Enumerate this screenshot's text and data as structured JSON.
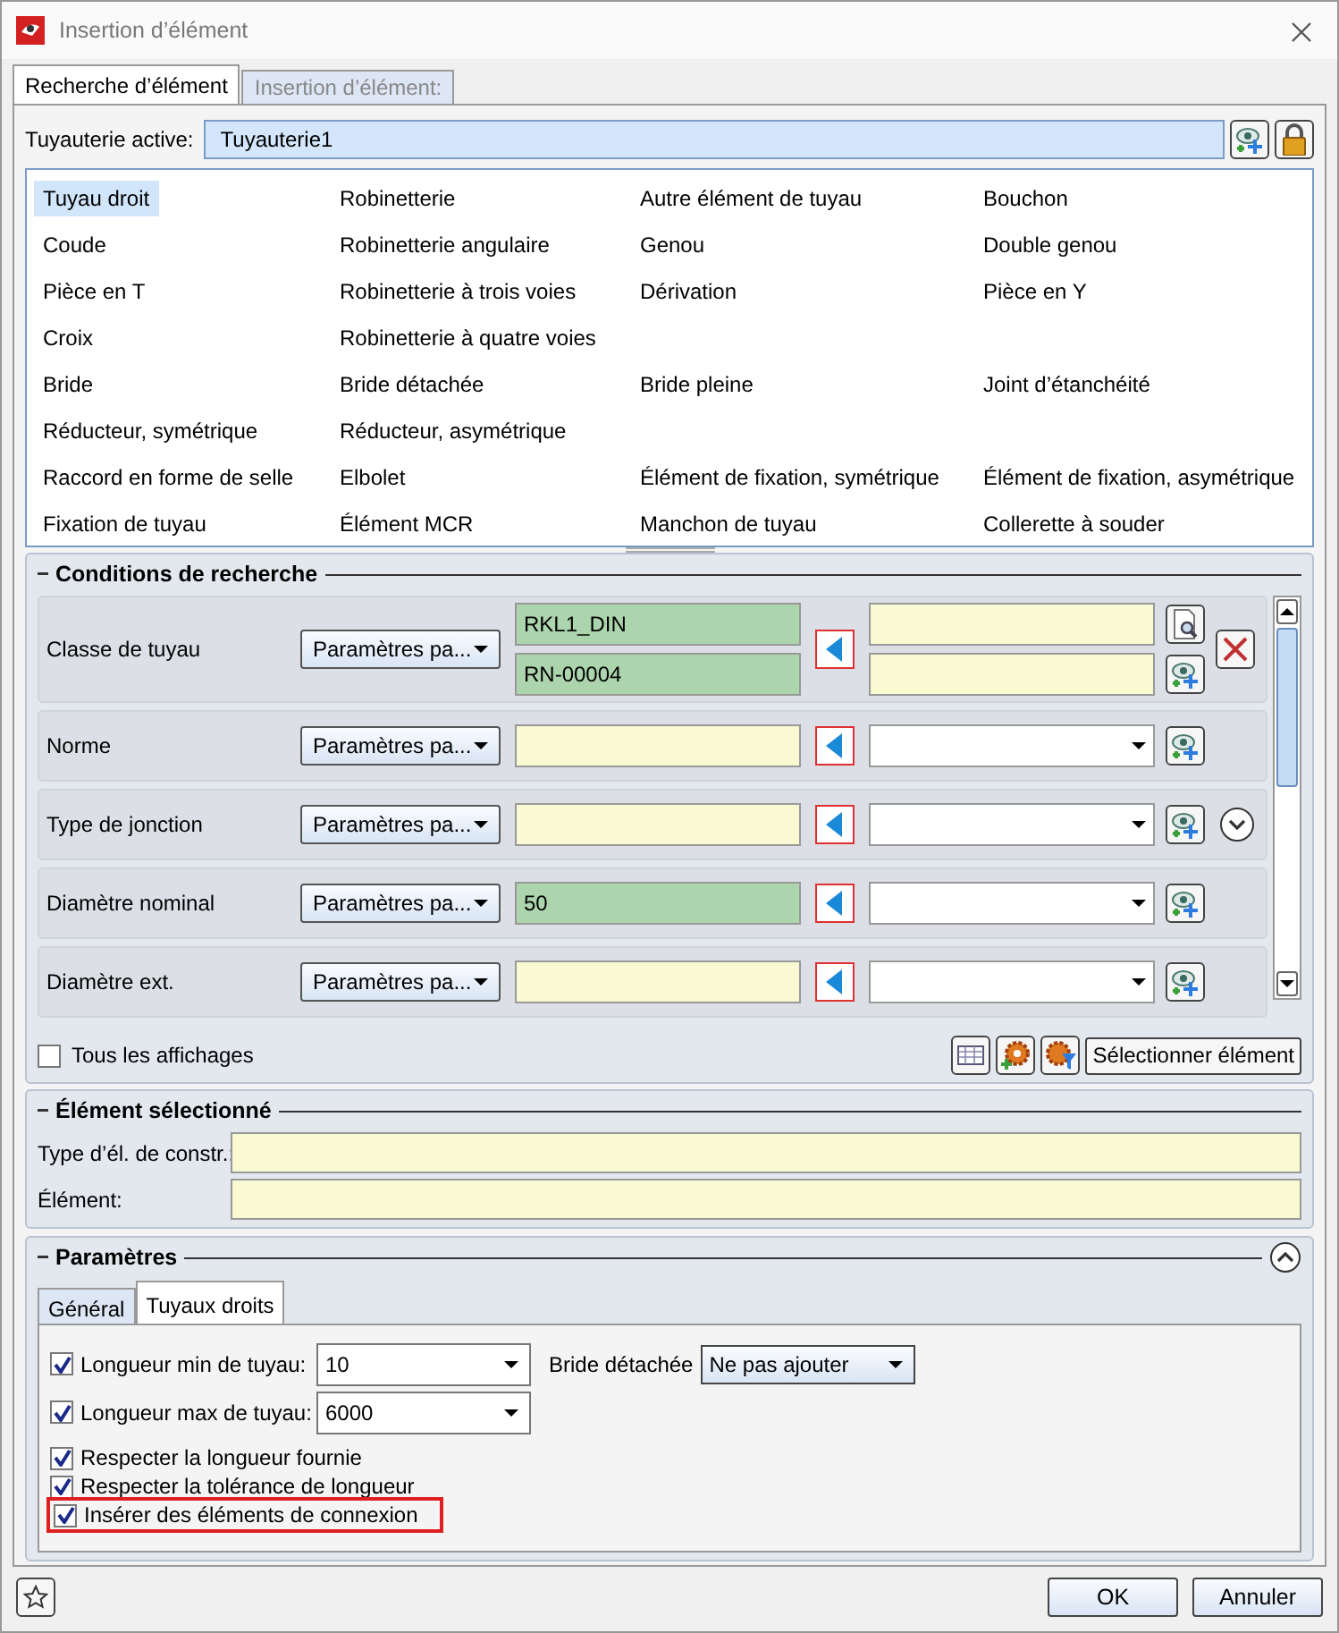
{
  "window": {
    "title": "Insertion d’élément"
  },
  "tabs": [
    {
      "label": "Recherche d’élément",
      "selected": true
    },
    {
      "label": "Insertion d’élément:",
      "selected": false
    }
  ],
  "active_piping": {
    "label": "Tuyauterie active:",
    "value": "Tuyauterie1"
  },
  "element_rows": [
    [
      {
        "label": "Tuyau droit",
        "selected": true
      },
      {
        "label": "Robinetterie",
        "selected": false
      },
      {
        "label": "Autre élément de tuyau",
        "selected": false
      },
      {
        "label": "Bouchon",
        "selected": false
      }
    ],
    [
      {
        "label": "Coude",
        "selected": false
      },
      {
        "label": "Robinetterie angulaire",
        "selected": false
      },
      {
        "label": "Genou",
        "selected": false
      },
      {
        "label": "Double genou",
        "selected": false
      }
    ],
    [
      {
        "label": "Pièce en T",
        "selected": false
      },
      {
        "label": "Robinetterie à trois voies",
        "selected": false
      },
      {
        "label": "Dérivation",
        "selected": false
      },
      {
        "label": "Pièce en Y",
        "selected": false
      }
    ],
    [
      {
        "label": "Croix",
        "selected": false
      },
      {
        "label": "Robinetterie à quatre voies",
        "selected": false
      }
    ],
    [
      {
        "label": "Bride",
        "selected": false
      },
      {
        "label": "Bride détachée",
        "selected": false
      },
      {
        "label": "Bride pleine",
        "selected": false
      },
      {
        "label": "Joint d’étanchéité",
        "selected": false
      }
    ],
    [
      {
        "label": "Réducteur, symétrique",
        "selected": false
      },
      {
        "label": "Réducteur, asymétrique",
        "selected": false
      }
    ],
    [
      {
        "label": "Raccord en forme de selle",
        "selected": false
      },
      {
        "label": "Elbolet",
        "selected": false
      },
      {
        "label": "Élément de fixation, symétrique",
        "selected": false
      },
      {
        "label": "Élément de fixation, asymétrique",
        "selected": false
      }
    ],
    [
      {
        "label": "Fixation de tuyau",
        "selected": false
      },
      {
        "label": "Élément MCR",
        "selected": false
      },
      {
        "label": "Manchon de tuyau",
        "selected": false
      },
      {
        "label": "Collerette à souder",
        "selected": false
      }
    ]
  ],
  "search_conditions": {
    "title": "Conditions de recherche",
    "rows": [
      {
        "kind": "pair",
        "label": "Classe de tuyau",
        "mode": "Paramètres pa...",
        "values": [
          {
            "kind": "set",
            "value": "RKL1_DIN"
          },
          {
            "kind": "set",
            "value": "RN-00004"
          }
        ],
        "targets": [
          {
            "kind": "text"
          },
          {
            "kind": "text"
          }
        ]
      },
      {
        "kind": "single",
        "label": "Norme",
        "mode": "Paramètres pa...",
        "values": [
          {
            "kind": "empty"
          }
        ],
        "targets": [
          {
            "kind": "combo"
          }
        ]
      },
      {
        "kind": "expandable",
        "label": "Type de jonction",
        "mode": "Paramètres pa...",
        "values": [
          {
            "kind": "empty"
          }
        ],
        "targets": [
          {
            "kind": "combo"
          }
        ]
      },
      {
        "kind": "single",
        "label": "Diamètre nominal",
        "mode": "Paramètres pa...",
        "values": [
          {
            "kind": "set",
            "value": "50"
          }
        ],
        "targets": [
          {
            "kind": "combo"
          }
        ]
      },
      {
        "kind": "single",
        "label": "Diamètre ext.",
        "mode": "Paramètres pa...",
        "values": [
          {
            "kind": "empty"
          }
        ],
        "targets": [
          {
            "kind": "combo"
          }
        ]
      }
    ],
    "show_all": {
      "label": "Tous les affichages",
      "checked": false
    },
    "select_button": "Sélectionner élément"
  },
  "selected_element": {
    "title": "Élément sélectionné",
    "fields": [
      {
        "label": "Type d’él. de constr.:"
      },
      {
        "label": "Élément:"
      }
    ]
  },
  "parameters": {
    "title": "Paramètres",
    "tabs": [
      {
        "label": "Général",
        "selected": false
      },
      {
        "label": "Tuyaux droits",
        "selected": true
      }
    ],
    "options": [
      {
        "kind": "combo",
        "checked": true,
        "label": "Longueur min de tuyau:",
        "value": "10",
        "side_label": "Bride détachée",
        "side_value": "Ne pas ajouter"
      },
      {
        "kind": "combo",
        "checked": true,
        "label": "Longueur max de tuyau:",
        "value": "6000"
      },
      {
        "kind": "check",
        "checked": true,
        "label": "Respecter la longueur fournie"
      },
      {
        "kind": "check",
        "checked": true,
        "label": "Respecter la tolérance de longueur"
      },
      {
        "kind": "check",
        "checked": true,
        "label": "Insérer des éléments de connexion",
        "highlighted": true
      }
    ]
  },
  "footer": {
    "buttons": [
      "OK",
      "Annuler"
    ]
  }
}
